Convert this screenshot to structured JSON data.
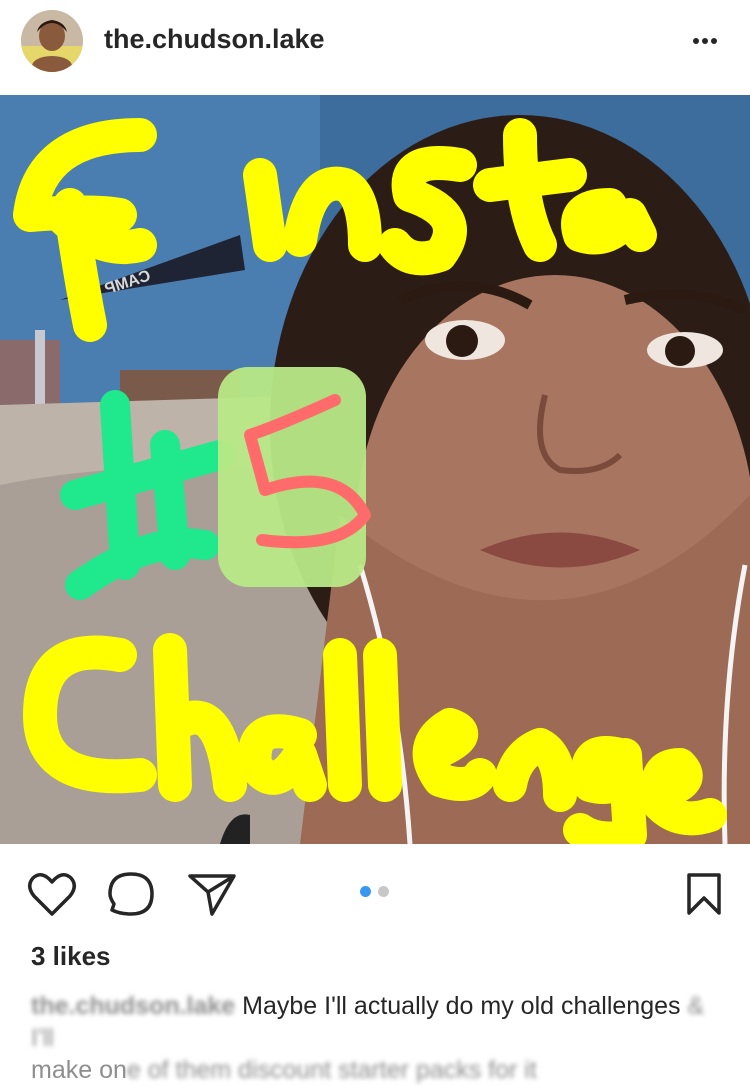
{
  "post": {
    "username": "the.chudson.lake",
    "likes": "3 likes",
    "caption_user": "the.chudson.lake",
    "caption_text": "Maybe I'll actually do my old challenges",
    "caption_blurred_tail": "& I'll",
    "caption_line2_start": "make on",
    "caption_line2_blurred": "e of them discount starter packs for it",
    "carousel": {
      "count": 2,
      "active_index": 0
    }
  },
  "photo": {
    "overlay_text_top": "Finsta",
    "overlay_text_mid": "#15",
    "overlay_text_bottom": "Challenge",
    "pennant_text": "CAMP RU"
  },
  "colors": {
    "accent_blue": "#3897f0",
    "overlay_yellow": "#ffff00",
    "overlay_green": "#1fe88d",
    "overlay_lightgreen": "#b8e986",
    "overlay_red": "#ff6b6b"
  },
  "icons": {
    "like": "heart-icon",
    "comment": "comment-icon",
    "share": "paper-plane-icon",
    "save": "bookmark-icon",
    "more": "more-dots-icon"
  }
}
